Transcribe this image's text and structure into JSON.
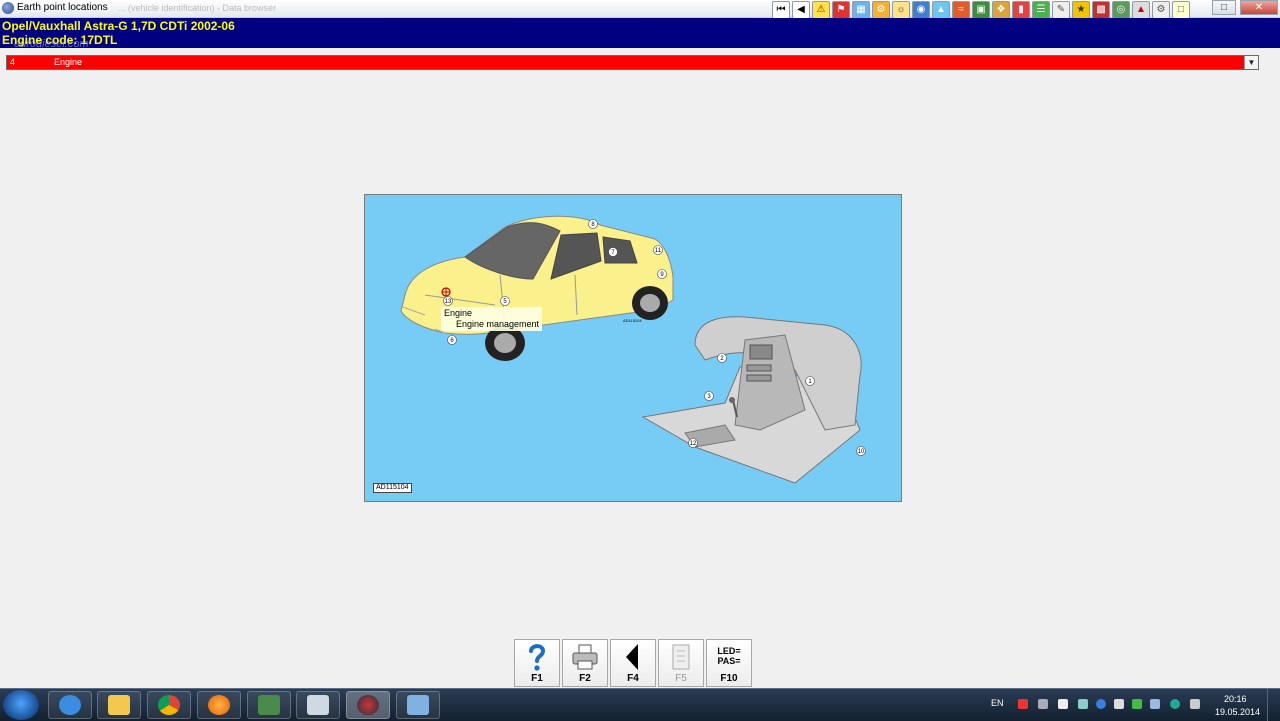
{
  "window": {
    "title": "Earth point locations",
    "subtitle": "... (vehicle identification) - Data browser"
  },
  "header": {
    "vehicle": "Opel/Vauxhall  Astra-G  1,7D CDTi 2002-06",
    "engine_code": "Engine code: 17DTL",
    "watermark": "eurodiesel.com"
  },
  "group_select": {
    "number": "4",
    "label": "Engine"
  },
  "diagram": {
    "code": "AD115104",
    "small_code": "AD115104",
    "tooltip_title": "Engine",
    "tooltip_item": "Engine management",
    "car_callouts": [
      "8",
      "7",
      "11",
      "9",
      "13",
      "5",
      "6"
    ],
    "dash_callouts": [
      "2",
      "1",
      "3",
      "12",
      "10"
    ]
  },
  "function_keys": [
    {
      "label": "F1",
      "icon": "help-icon",
      "enabled": true
    },
    {
      "label": "F2",
      "icon": "printer-icon",
      "enabled": true
    },
    {
      "label": "F4",
      "icon": "back-arrow-icon",
      "enabled": true
    },
    {
      "label": "F5",
      "icon": "document-icon",
      "enabled": false
    },
    {
      "label": "F10",
      "icon": "led-pas-icon",
      "enabled": true,
      "icon_text_1": "LED=",
      "icon_text_2": "PAS="
    }
  ],
  "taskbar": {
    "language": "EN",
    "time": "20:16",
    "date": "19.05.2014",
    "apps": [
      "internet-explorer-icon",
      "file-explorer-icon",
      "chrome-icon",
      "firefox-icon",
      "task-manager-icon",
      "pc-icon",
      "autodata-icon",
      "window-icon"
    ]
  },
  "colors": {
    "header_bg": "#000080",
    "header_text": "#ffff00",
    "select_bg": "#ff0000",
    "diagram_bg": "#77ccf5",
    "car_body": "#faf08c"
  }
}
